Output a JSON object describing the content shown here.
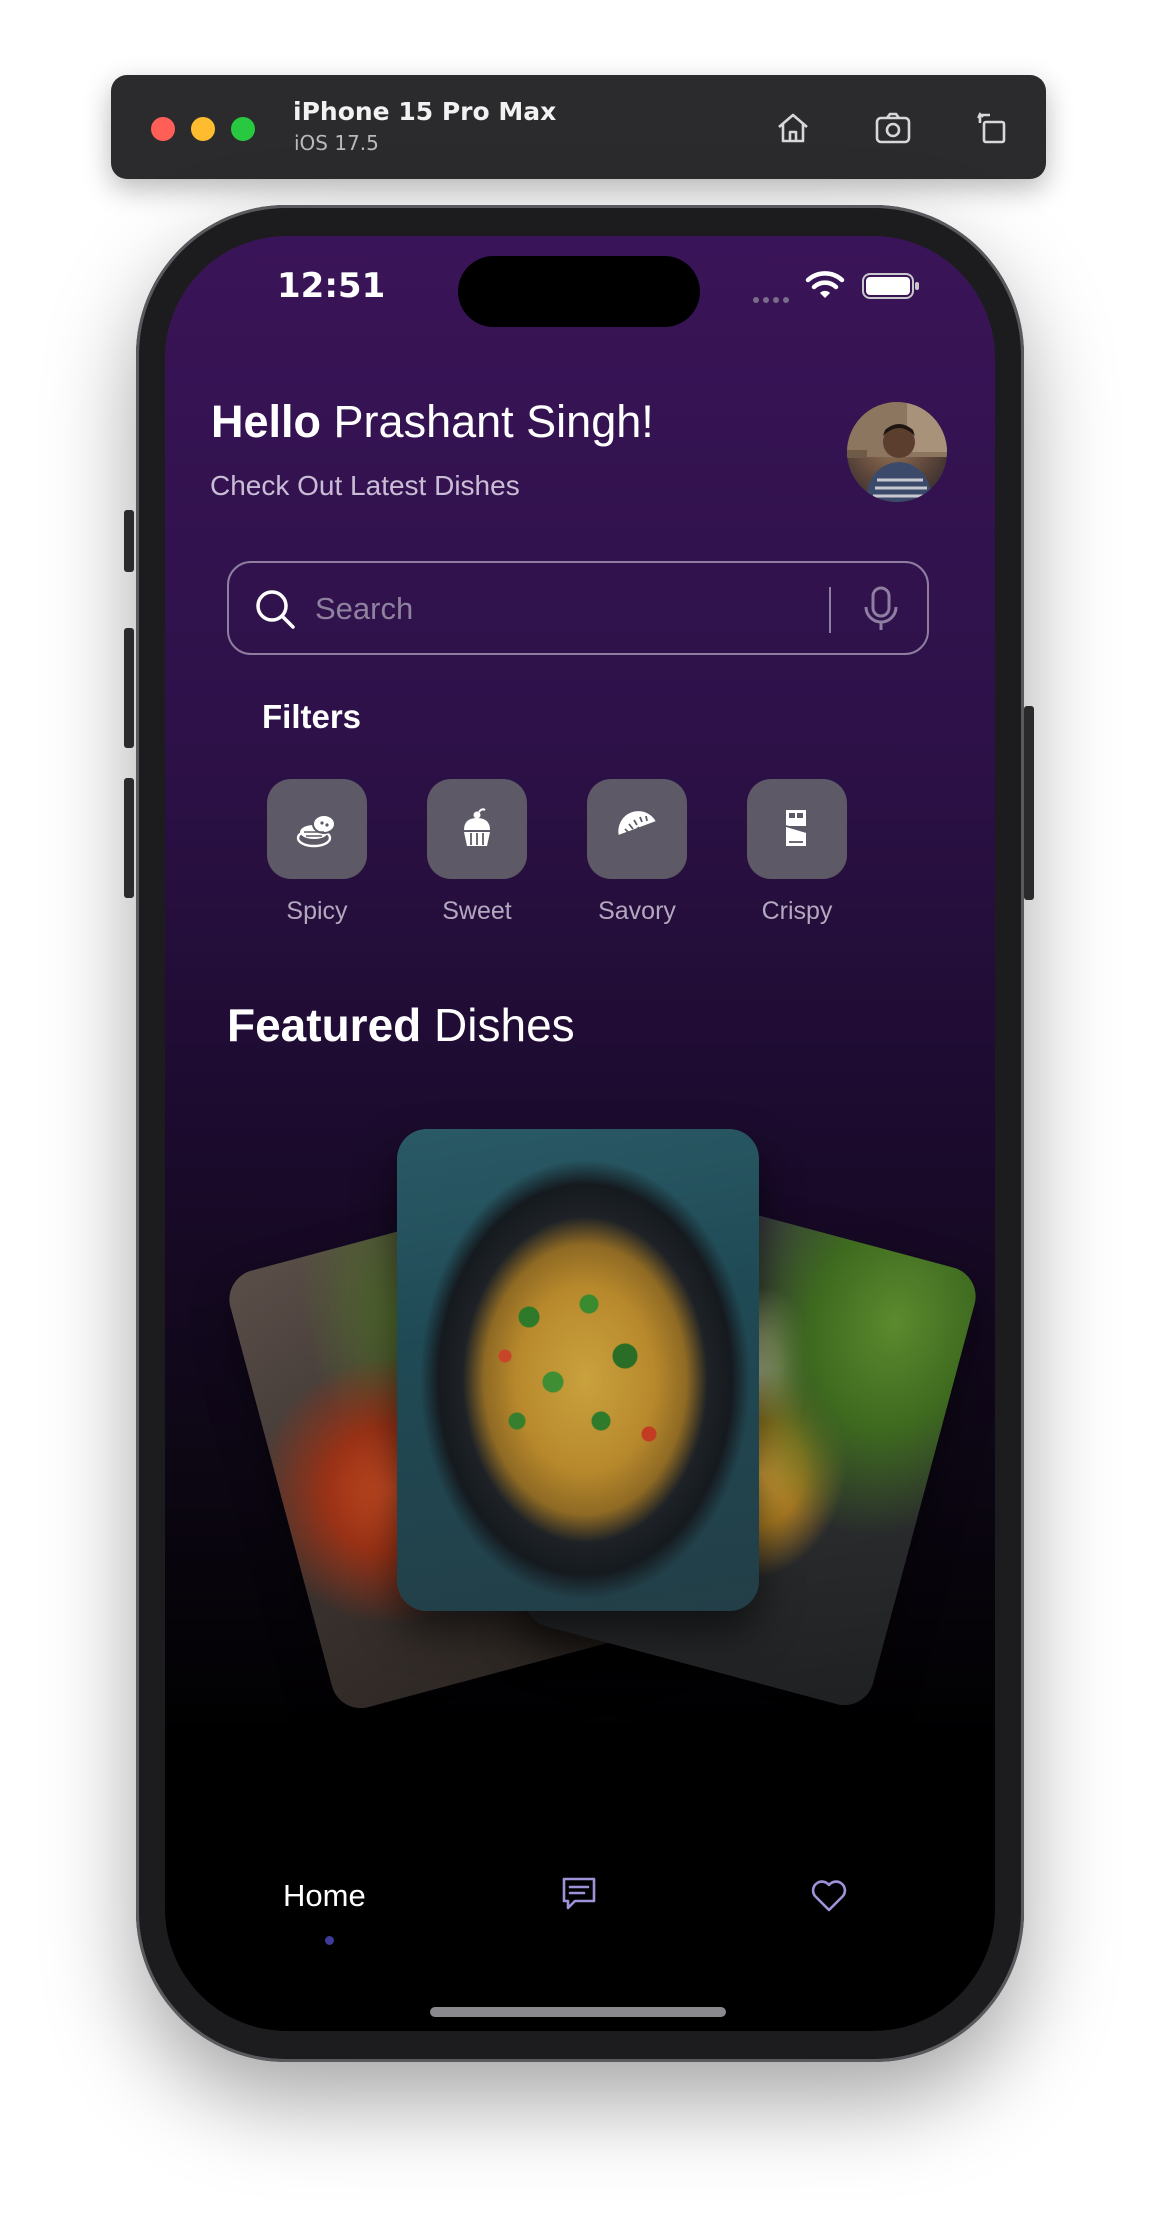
{
  "simulator": {
    "device_name": "iPhone 15 Pro Max",
    "os_version": "iOS 17.5",
    "tools": [
      "home-icon",
      "screenshot-icon",
      "rotate-icon"
    ]
  },
  "status_bar": {
    "time": "12:51",
    "icons": [
      "signal-dots-icon",
      "wifi-icon",
      "battery-icon"
    ]
  },
  "header": {
    "greeting_bold": "Hello",
    "user_name": "Prashant Singh!",
    "subtitle": "Check Out Latest Dishes"
  },
  "search": {
    "placeholder": "Search",
    "icons": [
      "search-icon",
      "microphone-icon"
    ]
  },
  "filters": {
    "title": "Filters",
    "items": [
      {
        "label": "Spicy",
        "icon": "spicy-dish-icon"
      },
      {
        "label": "Sweet",
        "icon": "cupcake-icon"
      },
      {
        "label": "Savory",
        "icon": "gujiya-icon"
      },
      {
        "label": "Crispy",
        "icon": "chocolate-bar-icon"
      }
    ]
  },
  "featured": {
    "title_bold": "Featured",
    "title_rest": "Dishes"
  },
  "bottom_nav": {
    "items": [
      {
        "label": "Home",
        "active": true
      },
      {
        "icon": "chat-icon"
      },
      {
        "icon": "heart-icon"
      }
    ],
    "active_color": "#3e3a9a"
  },
  "colors": {
    "bg_top": "#3a1458",
    "bg_bottom": "#000000",
    "tile": "#5d5966",
    "accent_text": "#ffffff"
  }
}
